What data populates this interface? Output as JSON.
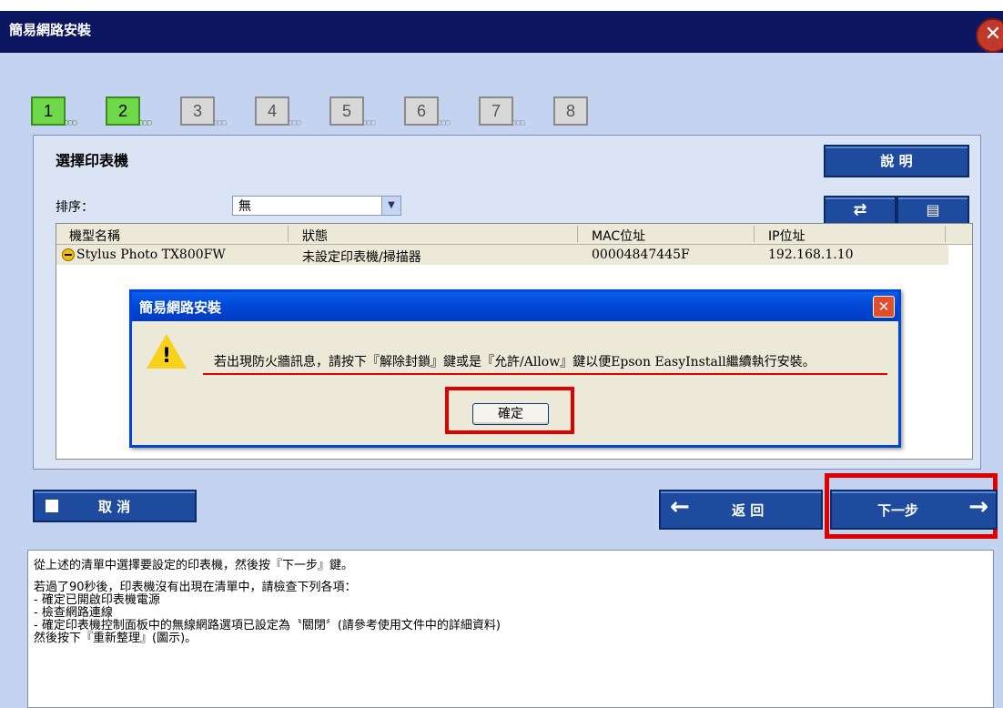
{
  "window": {
    "title": "簡易網路安裝",
    "close_icon": "close-x-icon"
  },
  "steps": [
    {
      "label": "1",
      "state": "done"
    },
    {
      "label": "2",
      "state": "done"
    },
    {
      "label": "3",
      "state": "pending"
    },
    {
      "label": "4",
      "state": "pending"
    },
    {
      "label": "5",
      "state": "pending"
    },
    {
      "label": "6",
      "state": "pending"
    },
    {
      "label": "7",
      "state": "pending"
    },
    {
      "label": "8",
      "state": "pending"
    }
  ],
  "panel": {
    "title": "選擇印表機",
    "help_label": "說 明",
    "sort_label": "排序：",
    "sort_value": "無",
    "refresh_icon": "refresh-arrows-icon",
    "config_icon": "settings-window-icon"
  },
  "list": {
    "headers": [
      "機型名稱",
      "狀態",
      "MAC位址",
      "IP位址"
    ],
    "rows": [
      {
        "model": "Stylus Photo TX800FW",
        "status": "未設定印表機/掃描器",
        "mac": "00004847445F",
        "ip": "192.168.1.10"
      }
    ]
  },
  "dialog": {
    "title": "簡易網路安裝",
    "message": "若出現防火牆訊息，請按下『解除封鎖』鍵或是『允許/Allow』鍵以便Epson EasyInstall繼續執行安裝。",
    "ok_label": "確定"
  },
  "buttons": {
    "cancel_label": "取 消",
    "back_label": "返 回",
    "next_label": "下一步"
  },
  "info": {
    "lines": [
      "從上述的清單中選擇要設定的印表機，然後按『下一步』鍵。",
      "若過了90秒後，印表機沒有出現在清單中，請檢查下列各項：",
      "- 確定已開啟印表機電源",
      "- 檢查網路連線",
      "- 確定印表機控制面板中的無線網路選項已設定為〝關閉〞(請參考使用文件中的詳細資料)",
      "然後按下『重新整理』(圖示)。"
    ]
  },
  "colors": {
    "title_bar": "#0d1660",
    "window_bg": "#c3d3f0",
    "button_blue": "#1f4b9e",
    "highlight_red": "#e00000",
    "step_done": "#6fd84a"
  }
}
